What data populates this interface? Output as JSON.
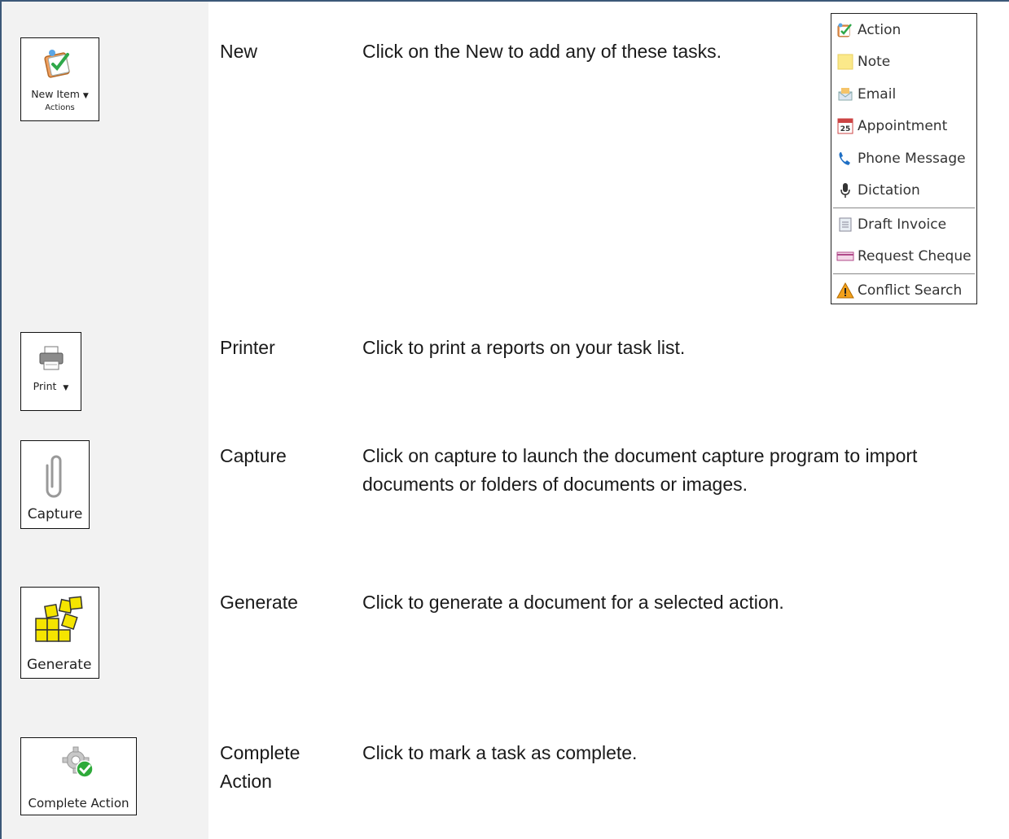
{
  "rows": [
    {
      "label": "New",
      "desc": "Click on the New to add any of these tasks.",
      "button": {
        "text": "New Item",
        "subtext": "Actions",
        "icon": "checklist-icon"
      }
    },
    {
      "label": "Printer",
      "desc": "Click to print a reports on your task list.",
      "button": {
        "text": "Print",
        "icon": "printer-icon"
      }
    },
    {
      "label": "Capture",
      "desc": "Click on capture to launch the document capture program to import documents or folders of documents or images.",
      "button": {
        "text": "Capture",
        "icon": "paperclip-icon"
      }
    },
    {
      "label": "Generate",
      "desc": "Click to generate a document for a selected action.",
      "button": {
        "text": "Generate",
        "icon": "puzzle-blocks-icon"
      }
    },
    {
      "label": "Complete Action",
      "desc": "Click to mark a task as complete.",
      "button": {
        "text": "Complete Action",
        "icon": "gear-check-icon"
      }
    }
  ],
  "new_menu": {
    "items": [
      {
        "label": "Action",
        "icon": "action-icon"
      },
      {
        "label": "Note",
        "icon": "note-icon"
      },
      {
        "label": "Email",
        "icon": "email-icon"
      },
      {
        "label": "Appointment",
        "icon": "calendar-icon",
        "icon_text": "25"
      },
      {
        "label": "Phone Message",
        "icon": "phone-icon"
      },
      {
        "label": "Dictation",
        "icon": "microphone-icon"
      },
      {
        "label": "Draft Invoice",
        "icon": "invoice-icon"
      },
      {
        "label": "Request Cheque",
        "icon": "cheque-icon"
      },
      {
        "label": "Conflict Search",
        "icon": "warning-icon"
      }
    ]
  },
  "colors": {
    "frame": "#3c5878",
    "left_column": "#f2f2f2",
    "generate_yellow": "#f5e500",
    "check_green": "#2eaa3a"
  }
}
